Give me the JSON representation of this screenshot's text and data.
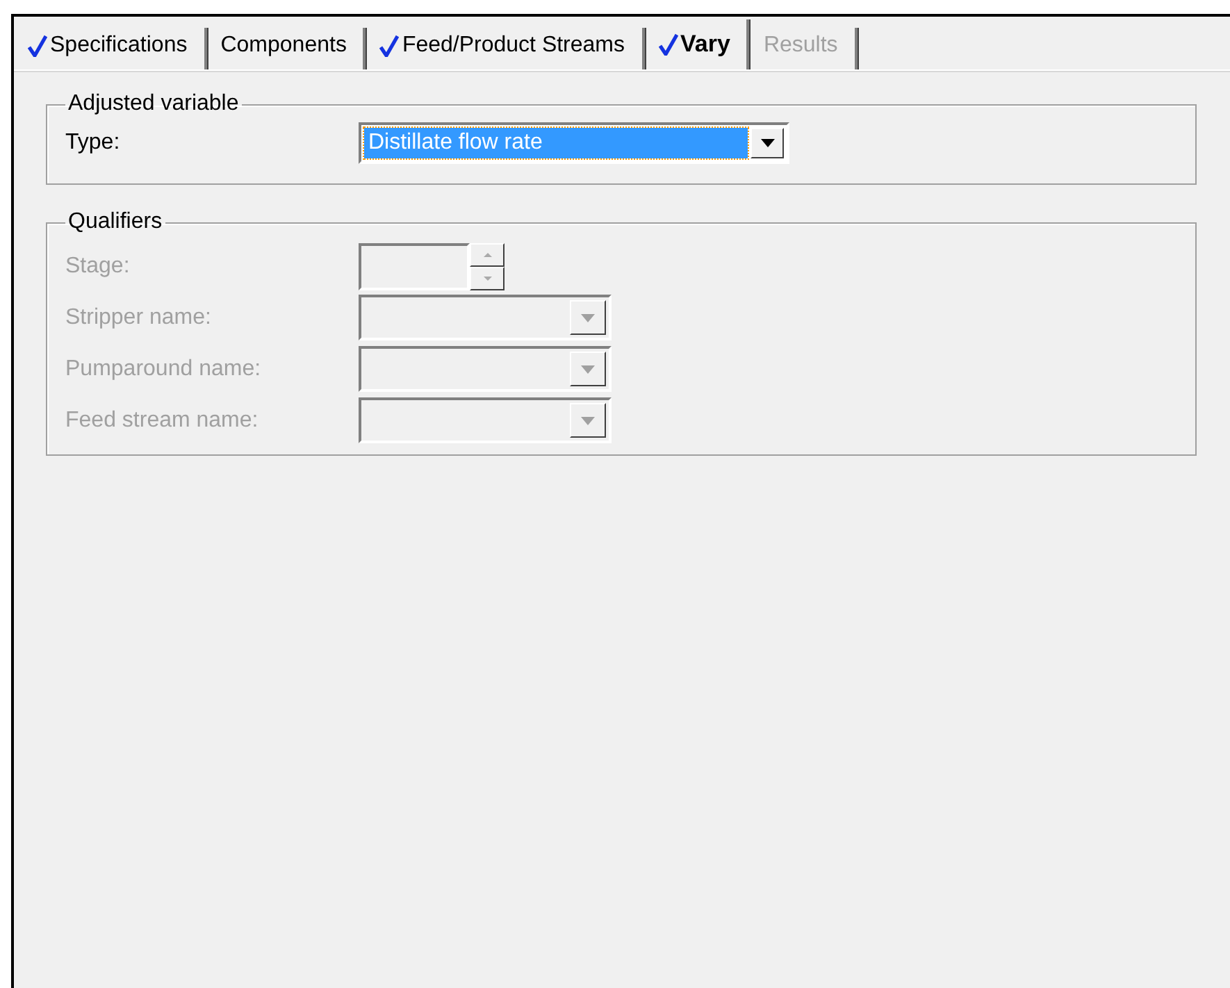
{
  "tabs": [
    {
      "label": "Specifications",
      "checked": true,
      "selected": false,
      "disabled": false
    },
    {
      "label": "Components",
      "checked": false,
      "selected": false,
      "disabled": false
    },
    {
      "label": "Feed/Product Streams",
      "checked": true,
      "selected": false,
      "disabled": false
    },
    {
      "label": "Vary",
      "checked": true,
      "selected": true,
      "disabled": false
    },
    {
      "label": "Results",
      "checked": false,
      "selected": false,
      "disabled": true
    }
  ],
  "adjusted_variable": {
    "title": "Adjusted variable",
    "type_label": "Type:",
    "type_value": "Distillate flow rate"
  },
  "qualifiers": {
    "title": "Qualifiers",
    "fields": [
      {
        "label": "Stage:",
        "kind": "spin",
        "disabled": true
      },
      {
        "label": "Stripper name:",
        "kind": "combo",
        "disabled": true
      },
      {
        "label": "Pumparound name:",
        "kind": "combo",
        "disabled": true
      },
      {
        "label": "Feed stream name:",
        "kind": "combo",
        "disabled": true
      }
    ]
  }
}
